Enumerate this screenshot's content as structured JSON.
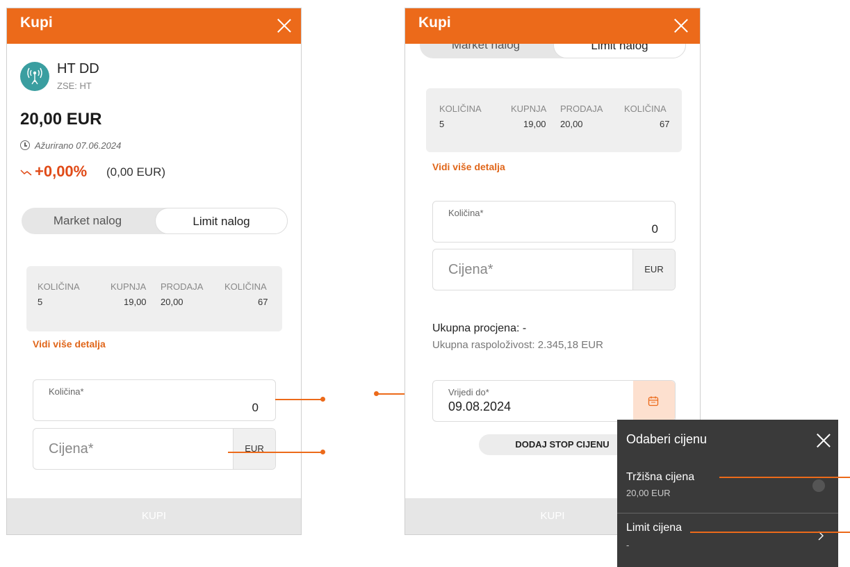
{
  "screen1": {
    "header_title": "Kupi",
    "stock": {
      "name": "HT DD",
      "exchange": "ZSE: HT"
    },
    "price": "20,00 EUR",
    "updated": "Ažurirano 07.06.2024",
    "change": {
      "percent": "+0,00%",
      "absolute": "(0,00 EUR)"
    },
    "tabs": [
      {
        "label": "Market nalog"
      },
      {
        "label": "Limit nalog"
      }
    ],
    "book": {
      "headers": [
        "KOLIČINA",
        "KUPNJA",
        "PRODAJA",
        "KOLIČINA"
      ],
      "values": [
        "5",
        "19,00",
        "20,00",
        "67"
      ]
    },
    "more_link": "Vidi više detalja",
    "quantity": {
      "label": "Količina*",
      "value": "0"
    },
    "price_field": {
      "placeholder": "Cijena*",
      "unit": "EUR"
    },
    "buy_label": "KUPI"
  },
  "screen2": {
    "header_title": "Kupi",
    "tabs": [
      {
        "label": "Market nalog"
      },
      {
        "label": "Limit nalog"
      }
    ],
    "book": {
      "headers": [
        "KOLIČINA",
        "KUPNJA",
        "PRODAJA",
        "KOLIČINA"
      ],
      "values": [
        "5",
        "19,00",
        "20,00",
        "67"
      ]
    },
    "more_link": "Vidi više detalja",
    "quantity": {
      "label": "Količina*",
      "value": "0"
    },
    "price_field": {
      "placeholder": "Cijena*",
      "unit": "EUR"
    },
    "total_estimate": "Ukupna procjena: -",
    "availability": "Ukupna raspoloživost: 2.345,18 EUR",
    "valid_until": {
      "label": "Vrijedi do*",
      "value": "09.08.2024"
    },
    "stop_price_button": "DODAJ STOP CIJENU",
    "buy_label": "KUPI"
  },
  "price_picker": {
    "title": "Odaberi cijenu",
    "options": [
      {
        "label": "Tržišna cijena",
        "sublabel": "20,00 EUR"
      },
      {
        "label": "Limit cijena",
        "sublabel": "-"
      }
    ]
  },
  "colors": {
    "accent": "#ec6a1a",
    "teal": "#3a9ea0",
    "dark_panel": "#3a3a3a"
  },
  "icons": [
    "close-icon",
    "antenna-icon",
    "clock-icon",
    "trend-icon",
    "calendar-icon",
    "chevron-right-icon"
  ]
}
